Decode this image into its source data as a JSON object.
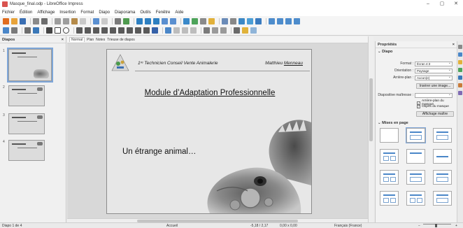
{
  "window": {
    "title": "Masque_final.odp - LibreOffice Impress",
    "minimize": "–",
    "restore": "▢",
    "close": "✕"
  },
  "menu": [
    "Fichier",
    "Édition",
    "Affichage",
    "Insertion",
    "Format",
    "Diapo",
    "Diaporama",
    "Outils",
    "Fenêtre",
    "Aide"
  ],
  "slides_panel": {
    "title": "Diapos",
    "close": "×",
    "numbers": [
      "1",
      "2",
      "3",
      "4"
    ]
  },
  "editor_tabs": [
    "Normal",
    "Plan",
    "Notes",
    "Trieuse de diapos"
  ],
  "slide": {
    "header_left": "1ʳᵉ Technicien Conseil Vente Animalerie",
    "header_right_first": "Matthieu",
    "header_right_last": "Menneau",
    "title": "Module d’Adaptation Professionnelle",
    "subtitle": "Un étrange animal…"
  },
  "sidebar": {
    "title": "Propriétés",
    "close": "×",
    "section_slide": "Diapo",
    "format_label": "Format :",
    "format_value": "Écran 4:3",
    "orientation_label": "Orientation :",
    "orientation_value": "Paysage",
    "background_label": "Arrière-plan :",
    "background_value": "Aucun(e)",
    "insert_image": "Insérer une image...",
    "master_label": "Diapositive maîtresse :",
    "master_value": "",
    "chk_master_bg": "Arrière-plan du masque",
    "chk_master_objects": "Objets du masque",
    "master_view_btn": "Affichage maître",
    "section_layouts": "Mises en page"
  },
  "status": {
    "slide_count": "Diapo 1 de 4",
    "master_name": "Accueil",
    "position": "-5,18 / 2,17",
    "size": "0,00 x 0,00",
    "language": "Français (France)",
    "zoom_minus": "−",
    "zoom_plus": "+"
  },
  "colors": {
    "accent": "#4a86c8",
    "selection": "#7ea6d8"
  }
}
